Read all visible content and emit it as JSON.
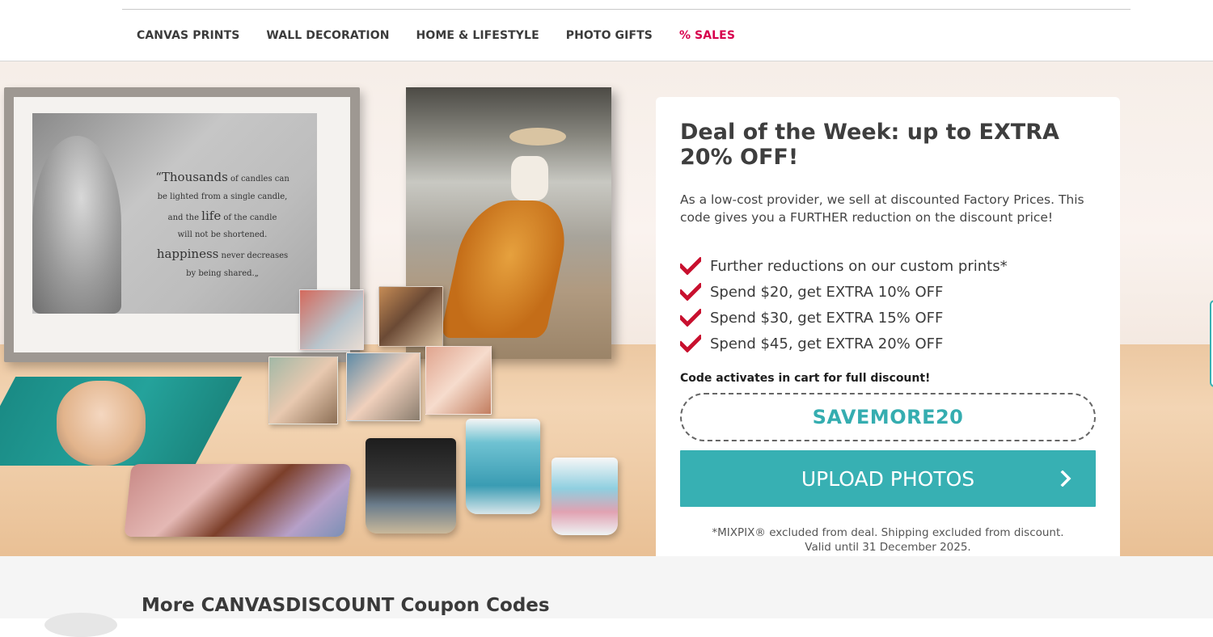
{
  "nav": {
    "items": [
      {
        "label": "CANVAS PRINTS"
      },
      {
        "label": "WALL DECORATION"
      },
      {
        "label": "HOME & LIFESTYLE"
      },
      {
        "label": "PHOTO GIFTS"
      },
      {
        "label": "% SALES"
      }
    ]
  },
  "hero": {
    "quote": {
      "line1_lead": "“Thousands",
      "line1_rest": " of candles can",
      "line2": "be lighted from a single candle,",
      "line3_a": "and the ",
      "line3_life": "life",
      "line3_b": " of the candle",
      "line4": "will not be shortened.",
      "line5_happiness": "happiness",
      "line5_rest": " never decreases",
      "line6": "by being shared.„"
    }
  },
  "deal": {
    "title": "Deal of the Week: up to EXTRA 20% OFF!",
    "description": "As a low-cost provider, we sell at discounted Factory Prices. This code gives you a FURTHER reduction on the discount price!",
    "benefits": [
      "Further reductions on our custom prints*",
      "Spend $20, get EXTRA 10% OFF",
      "Spend $30, get EXTRA 15% OFF",
      "Spend $45, get EXTRA 20% OFF"
    ],
    "code_note": "Code activates in cart for full discount!",
    "code": "SAVEMORE20",
    "upload_label": "UPLOAD PHOTOS",
    "fine_print_1": "*MIXPIX® excluded from deal. Shipping excluded from discount.",
    "fine_print_2": "Valid until 31 December 2025."
  },
  "more": {
    "title": "More CANVASDISCOUNT Coupon Codes"
  },
  "colors": {
    "accent": "#37b0b3",
    "sales": "#d7004d",
    "check": "#c8102e"
  }
}
